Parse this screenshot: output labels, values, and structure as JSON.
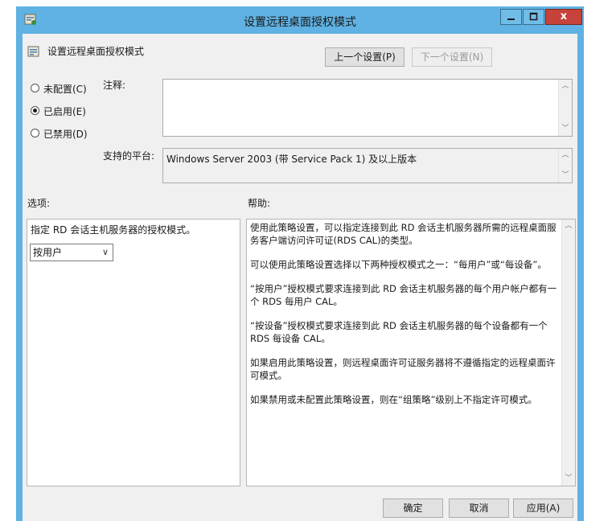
{
  "window": {
    "title": "设置远程桌面授权模式",
    "close_glyph": "x"
  },
  "header": {
    "setting_title": "设置远程桌面授权模式",
    "prev_button": "上一个设置(P)",
    "next_button": "下一个设置(N)"
  },
  "state": {
    "options": [
      {
        "label": "未配置(C)",
        "selected": false
      },
      {
        "label": "已启用(E)",
        "selected": true
      },
      {
        "label": "已禁用(D)",
        "selected": false
      }
    ]
  },
  "comment": {
    "label": "注释:",
    "value": ""
  },
  "platform": {
    "label": "支持的平台:",
    "value": "Windows Server 2003 (带 Service Pack 1) 及以上版本"
  },
  "options_pane": {
    "label": "选项:",
    "description": "指定 RD 会话主机服务器的授权模式。",
    "mode_select": {
      "value": "按用户"
    }
  },
  "help_pane": {
    "label": "帮助:",
    "paragraphs": [
      "使用此策略设置，可以指定连接到此 RD 会话主机服务器所需的远程桌面服务客户端访问许可证(RDS CAL)的类型。",
      "可以使用此策略设置选择以下两种授权模式之一：“每用户”或“每设备”。",
      "“按用户”授权模式要求连接到此 RD 会话主机服务器的每个用户帐户都有一个 RDS 每用户 CAL。",
      "“按设备”授权模式要求连接到此 RD 会话主机服务器的每个设备都有一个 RDS 每设备 CAL。",
      "如果启用此策略设置，则远程桌面许可证服务器将不遵循指定的远程桌面许可模式。",
      "如果禁用或未配置此策略设置，则在“组策略”级别上不指定许可模式。"
    ]
  },
  "footer": {
    "ok": "确定",
    "cancel": "取消",
    "apply": "应用(A)"
  }
}
